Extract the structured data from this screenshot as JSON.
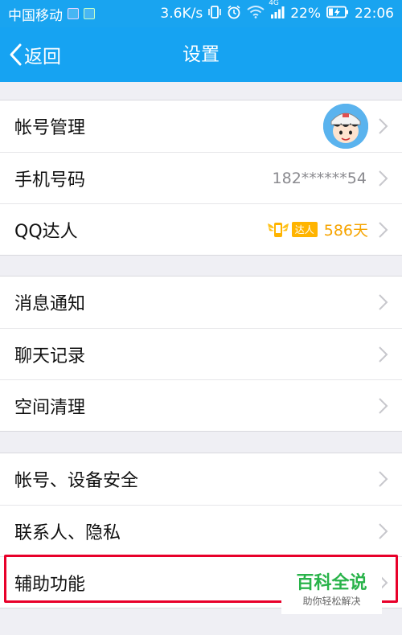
{
  "status_bar": {
    "carrier": "中国移动",
    "speed": "3.6K/s",
    "network": "4G",
    "battery": "22%",
    "time": "22:06"
  },
  "title_bar": {
    "back_label": "返回",
    "title": "设置"
  },
  "groups": [
    {
      "rows": [
        {
          "label": "帐号管理"
        },
        {
          "label": "手机号码",
          "value": "182******54"
        },
        {
          "label": "QQ达人",
          "badge": "达人",
          "days": "586天"
        }
      ]
    },
    {
      "rows": [
        {
          "label": "消息通知"
        },
        {
          "label": "聊天记录"
        },
        {
          "label": "空间清理"
        }
      ]
    },
    {
      "rows": [
        {
          "label": "帐号、设备安全"
        },
        {
          "label": "联系人、隐私"
        },
        {
          "label": "辅助功能"
        }
      ]
    }
  ],
  "watermark": {
    "title": "百科全说",
    "subtitle": "助你轻松解决"
  },
  "colors": {
    "header": "#16a3f2",
    "highlight": "#e8002a",
    "days": "#f6a400",
    "watermark_green": "#29b34a"
  }
}
